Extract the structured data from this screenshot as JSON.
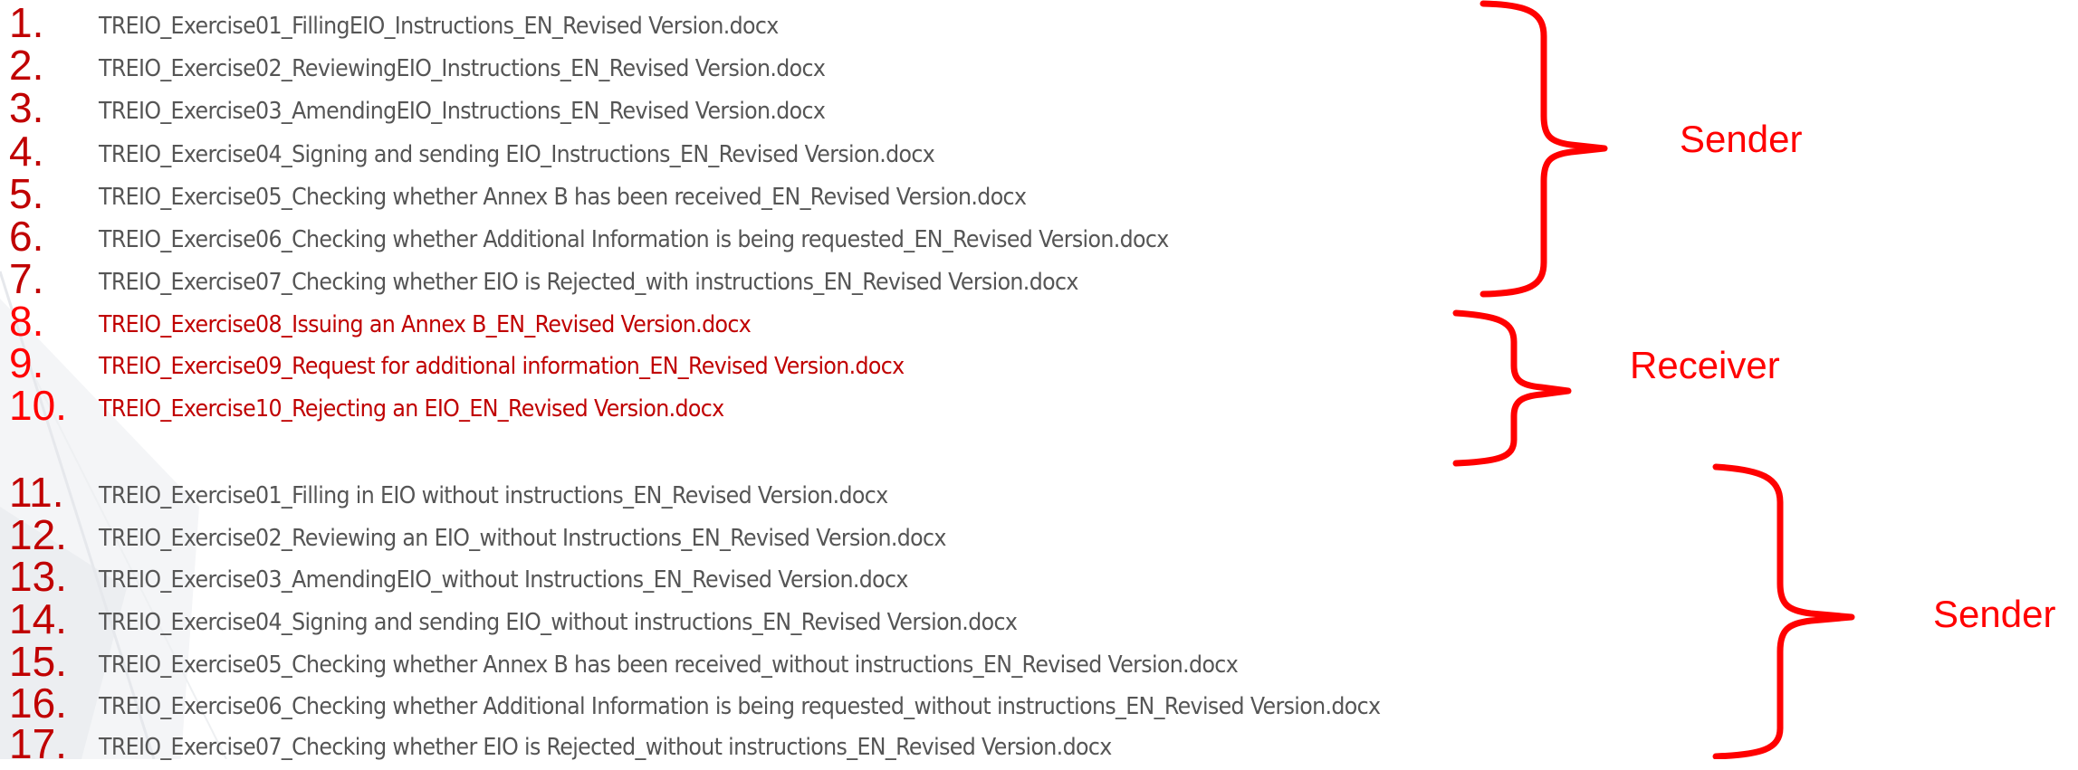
{
  "colors": {
    "number_red": "#c00000",
    "text_gray": "#555555",
    "text_red": "#c00000",
    "brace_red": "#ff0000",
    "label_red": "#ff0000"
  },
  "items": [
    {
      "number": "1.",
      "filename": "TREIO_Exercise01_FillingEIO_Instructions_EN_Revised Version.docx"
    },
    {
      "number": "2.",
      "filename": "TREIO_Exercise02_ReviewingEIO_Instructions_EN_Revised Version.docx"
    },
    {
      "number": "3.",
      "filename": "TREIO_Exercise03_AmendingEIO_Instructions_EN_Revised Version.docx"
    },
    {
      "number": "4.",
      "filename": "TREIO_Exercise04_Signing and sending EIO_Instructions_EN_Revised Version.docx"
    },
    {
      "number": "5.",
      "filename": "TREIO_Exercise05_Checking whether Annex B has been received_EN_Revised Version.docx"
    },
    {
      "number": "6.",
      "filename": "TREIO_Exercise06_Checking whether Additional Information is being requested_EN_Revised Version.docx"
    },
    {
      "number": "7.",
      "filename": "TREIO_Exercise07_Checking whether EIO is Rejected_with instructions_EN_Revised Version.docx"
    },
    {
      "number": "8.",
      "filename": "TREIO_Exercise08_Issuing an Annex B_EN_Revised Version.docx"
    },
    {
      "number": "9.",
      "filename": "TREIO_Exercise09_Request for additional information_EN_Revised Version.docx"
    },
    {
      "number": "10.",
      "filename": "TREIO_Exercise10_Rejecting an EIO_EN_Revised Version.docx"
    },
    {
      "number": "11.",
      "filename": "TREIO_Exercise01_Filling in EIO without instructions_EN_Revised Version.docx"
    },
    {
      "number": "12.",
      "filename": "TREIO_Exercise02_Reviewing an EIO_without Instructions_EN_Revised Version.docx"
    },
    {
      "number": "13.",
      "filename": "TREIO_Exercise03_AmendingEIO_without Instructions_EN_Revised Version.docx"
    },
    {
      "number": "14.",
      "filename": "TREIO_Exercise04_Signing and sending EIO_without instructions_EN_Revised Version.docx"
    },
    {
      "number": "15.",
      "filename": "TREIO_Exercise05_Checking whether Annex B has been received_without instructions_EN_Revised Version.docx"
    },
    {
      "number": "16.",
      "filename": "TREIO_Exercise06_Checking whether Additional Information is being requested_without instructions_EN_Revised Version.docx"
    },
    {
      "number": "17.",
      "filename": "TREIO_Exercise07_Checking whether EIO is Rejected_without instructions_EN_Revised Version.docx"
    }
  ],
  "groups": [
    {
      "label": "Sender"
    },
    {
      "label": "Receiver"
    },
    {
      "label": "Sender"
    }
  ]
}
